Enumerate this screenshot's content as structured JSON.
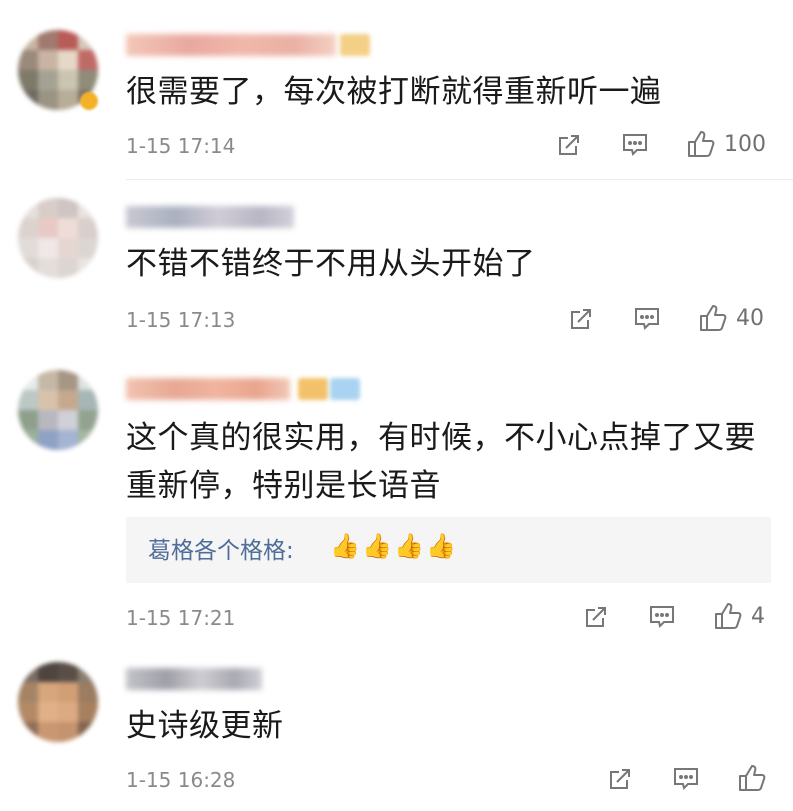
{
  "comments": [
    {
      "text": "很需要了，每次被打断就得重新听一遍",
      "time": "1-15 17:14",
      "likes": "100",
      "icons": [
        "share-icon",
        "comment-icon",
        "like-icon"
      ]
    },
    {
      "text": "不错不错终于不用从头开始了",
      "time": "1-15 17:13",
      "likes": "40",
      "icons": [
        "share-icon",
        "comment-icon",
        "like-icon"
      ]
    },
    {
      "text_line1": "这个真的很实用，有时候，不小心点掉了又要",
      "text_line2": "重新停，特别是长语音",
      "time": "1-15 17:21",
      "likes": "4",
      "reply": {
        "name": "葛格各个格格:",
        "emoji": [
          "👍",
          "👍",
          "👍",
          "👍"
        ]
      },
      "icons": [
        "share-icon",
        "comment-icon",
        "like-icon"
      ]
    },
    {
      "text": "史诗级更新",
      "time": "1-15 16:28",
      "likes": "",
      "icons": [
        "share-icon",
        "comment-icon",
        "like-icon"
      ]
    }
  ],
  "colors": {
    "text": "#1a1a1a",
    "time": "#8a8a8a",
    "reply_name": "#4f6d9a",
    "reply_bg": "#f5f5f5",
    "icon": "#777777"
  }
}
